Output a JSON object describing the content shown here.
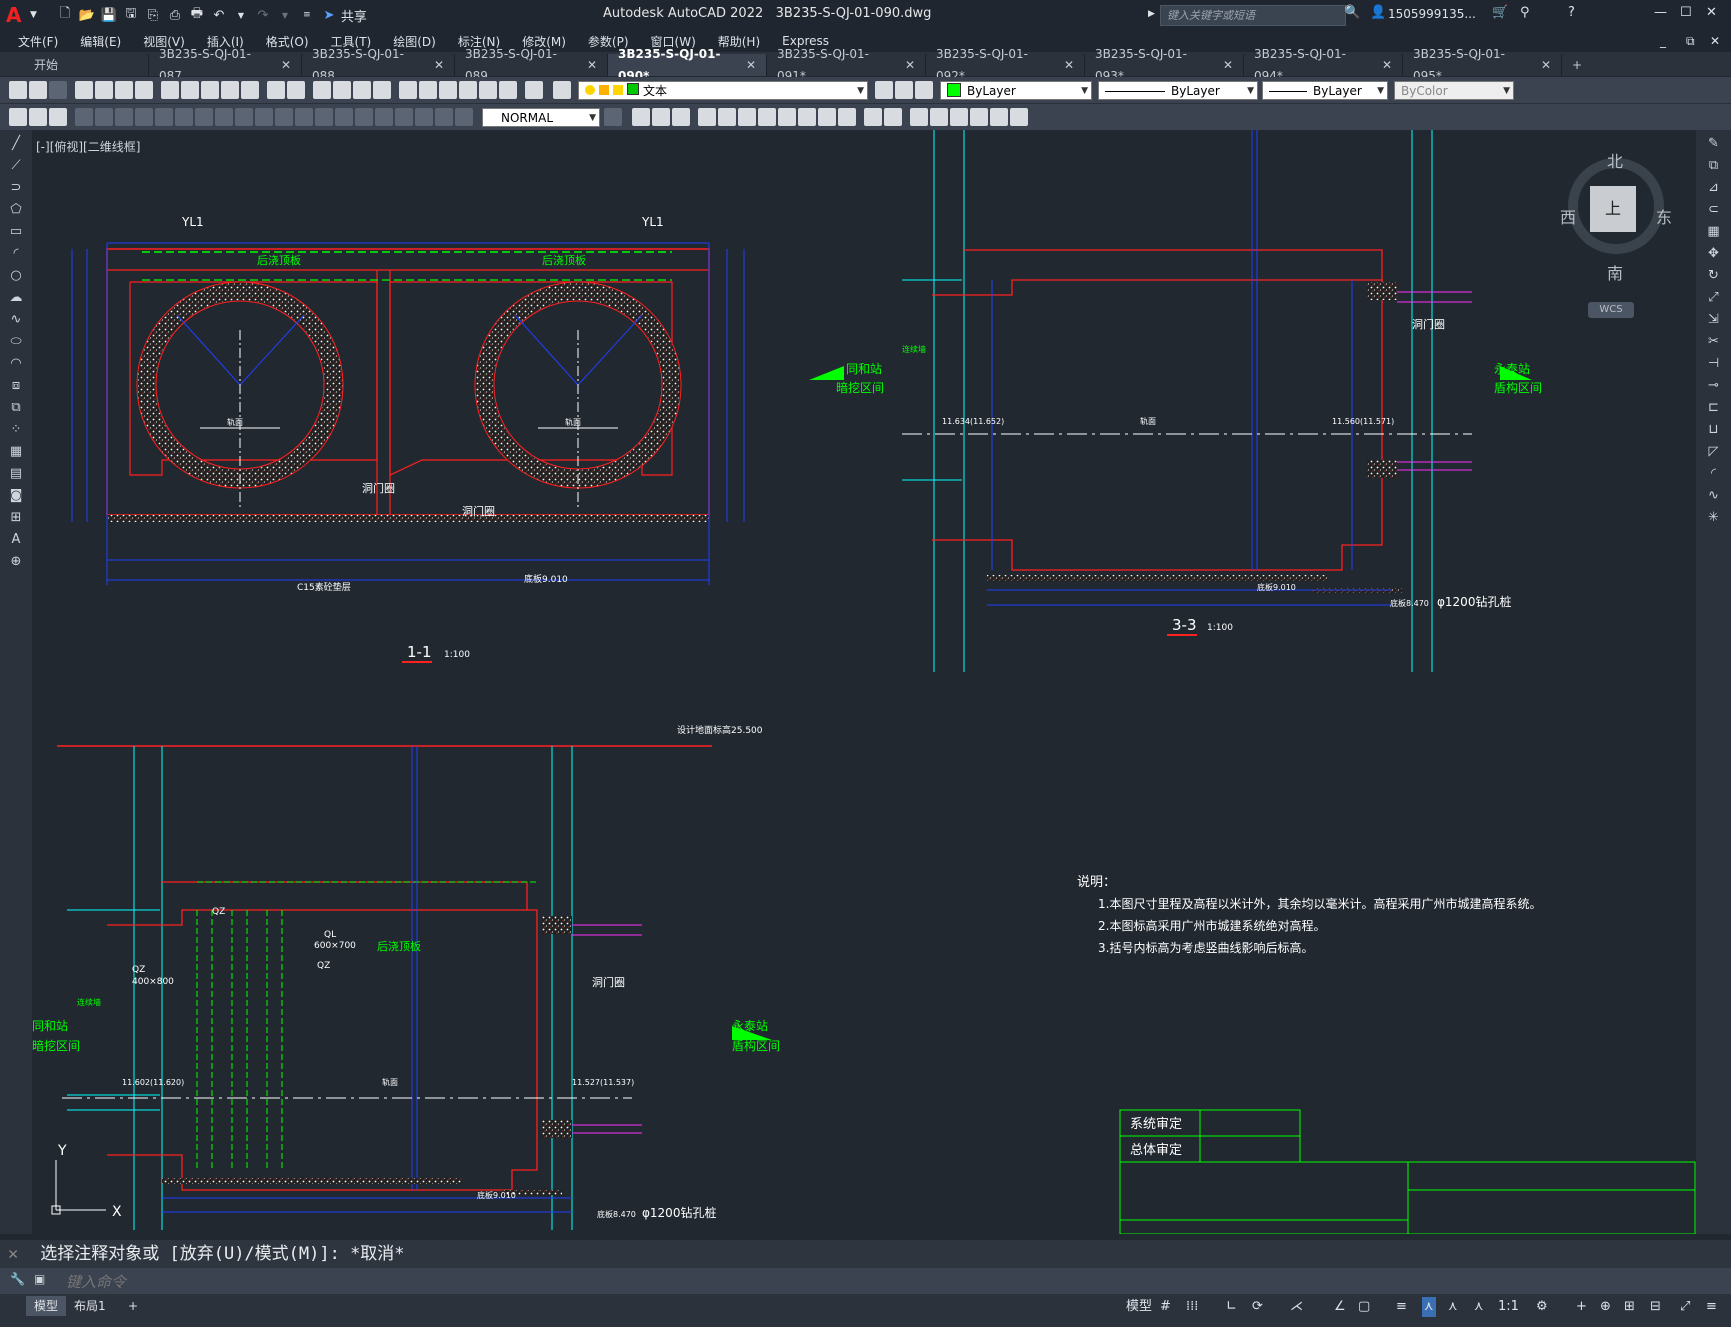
{
  "app": {
    "title": "Autodesk AutoCAD 2022",
    "filename": "3B235-S-QJ-01-090.dwg",
    "share_label": "共享",
    "search_placeholder": "键入关键字或短语",
    "user": "1505999135...",
    "logo_letter": "A"
  },
  "menu": [
    "文件(F)",
    "编辑(E)",
    "视图(V)",
    "插入(I)",
    "格式(O)",
    "工具(T)",
    "绘图(D)",
    "标注(N)",
    "修改(M)",
    "参数(P)",
    "窗口(W)",
    "帮助(H)",
    "Express"
  ],
  "tabs": [
    {
      "label": "开始",
      "closable": false,
      "active": false
    },
    {
      "label": "3B235-S-QJ-01-087",
      "closable": true,
      "active": false
    },
    {
      "label": "3B235-S-QJ-01-088",
      "closable": true,
      "active": false
    },
    {
      "label": "3B235-S-QJ-01-089",
      "closable": true,
      "active": false
    },
    {
      "label": "3B235-S-QJ-01-090*",
      "closable": true,
      "active": true
    },
    {
      "label": "3B235-S-QJ-01-091*",
      "closable": true,
      "active": false
    },
    {
      "label": "3B235-S-QJ-01-092*",
      "closable": true,
      "active": false
    },
    {
      "label": "3B235-S-QJ-01-093*",
      "closable": true,
      "active": false
    },
    {
      "label": "3B235-S-QJ-01-094*",
      "closable": true,
      "active": false
    },
    {
      "label": "3B235-S-QJ-01-095*",
      "closable": true,
      "active": false
    }
  ],
  "toolbar": {
    "layer_value": "文本",
    "color_value": "ByLayer",
    "linetype_value": "ByLayer",
    "lineweight_value": "ByLayer",
    "plotstyle_value": "ByColor",
    "dimstyle_value": "NORMAL",
    "layer_color": "#00c800",
    "color_swatch": "#00ff00"
  },
  "viewport_label": "[-][俯视][二维线框]",
  "viewcube": {
    "north": "北",
    "south": "南",
    "east": "东",
    "west": "西",
    "top": "上",
    "wcs": "WCS"
  },
  "drawing": {
    "section_1_1": {
      "title": "1-1",
      "scale": "1:100",
      "yl1": "YL1",
      "post_pour": "后浇顶板",
      "door_ring": "洞门圈",
      "cushion": "C15素砼垫层",
      "floor_elev": "底板9.010",
      "rail_top": "轨面"
    },
    "section_3_3": {
      "title": "3-3",
      "scale": "1:100",
      "station_left": [
        "同和站",
        "暗挖区间"
      ],
      "station_right": [
        "永泰站",
        "盾构区间"
      ],
      "door_ring": "洞门圈",
      "elev_left": "11.634(11.652)",
      "elev_right": "11.560(11.571)",
      "rail_top": "轨面",
      "floor_elev": "底板9.010",
      "bottom_elev": "底板8.470",
      "pile": "φ1200钻孔桩",
      "wall": "连续墙"
    },
    "plan": {
      "ground": "设计地面标高25.500",
      "qz": "QZ",
      "qz_size": "400×800",
      "ql": "QL",
      "ql_size": "600×700",
      "post_pour": "后浇顶板",
      "door_ring": "洞门圈",
      "station_left": [
        "同和站",
        "暗挖区间"
      ],
      "station_right": [
        "永泰站",
        "盾构区间"
      ],
      "elev_left": "11.602(11.620)",
      "elev_right": "11.527(11.537)",
      "rail_top": "轨面",
      "floor_elev": "底板9.010",
      "bottom_elev": "底板8.470",
      "pile": "φ1200钻孔桩",
      "wall": "连续墙"
    },
    "notes": {
      "title": "说明：",
      "items": [
        "1.本图尺寸里程及高程以米计外，其余均以毫米计。高程采用广州市城建高程系统。",
        "2.本图标高采用广州市城建系统绝对高程。",
        "3.括号内标高为考虑竖曲线影响后标高。"
      ]
    },
    "titleblock": {
      "row1": "系统审定",
      "row2": "总体审定"
    }
  },
  "command": {
    "history": "选择注释对象或 [放弃(U)/模式(M)]: *取消*",
    "placeholder": "键入命令"
  },
  "layout_tabs": [
    "模型",
    "布局1"
  ],
  "status": {
    "model": "模型",
    "scale": "1:1"
  }
}
